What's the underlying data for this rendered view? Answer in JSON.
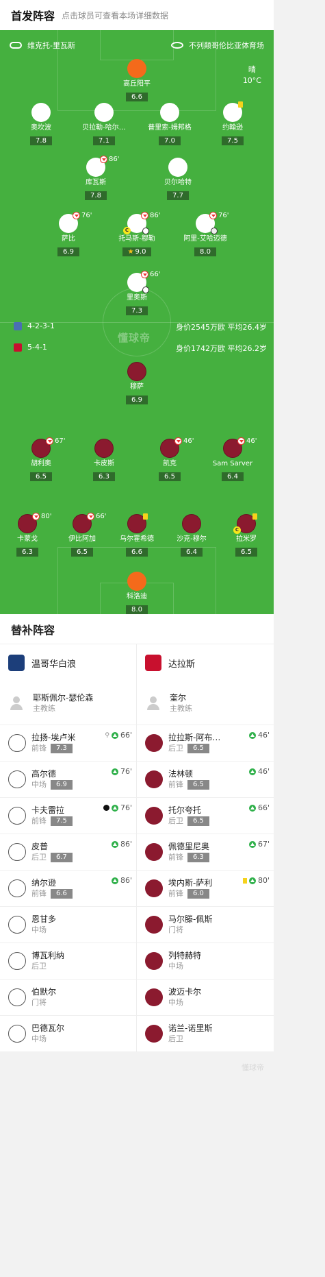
{
  "header": {
    "title": "首发阵容",
    "hint": "点击球员可查看本场详细数据"
  },
  "match": {
    "referee": "维克托-里瓦斯",
    "stadium": "不列颠哥伦比亚体育场",
    "weather": "晴",
    "temperature": "10°C",
    "watermark": "懂球帝"
  },
  "home": {
    "formation": "4-2-3-1",
    "value_text": "身价2545万欧 平均26.4岁",
    "players": [
      {
        "name": "高丘阳平",
        "rating": "6.6",
        "kit": "gk"
      },
      {
        "name": "奥坎波",
        "rating": "7.8",
        "kit": "white"
      },
      {
        "name": "贝拉勒-哈尔…",
        "rating": "7.1",
        "kit": "white"
      },
      {
        "name": "普里索-姆邦格",
        "rating": "7.0",
        "kit": "white"
      },
      {
        "name": "约翰逊",
        "rating": "7.5",
        "kit": "white",
        "yellow": true
      },
      {
        "name": "库瓦斯",
        "rating": "7.8",
        "kit": "white",
        "sub_out": "86'"
      },
      {
        "name": "贝尔哈特",
        "rating": "7.7",
        "kit": "white"
      },
      {
        "name": "萨比",
        "rating": "6.9",
        "kit": "white",
        "sub_out": "76'"
      },
      {
        "name": "托马斯-穆勒",
        "rating": "9.0",
        "kit": "white",
        "sub_out": "86'",
        "captain": "C",
        "goal": true,
        "mvp": true
      },
      {
        "name": "阿里-艾哈迈德",
        "rating": "8.0",
        "kit": "white",
        "sub_out": "76'",
        "assist": true
      },
      {
        "name": "里奥斯",
        "rating": "7.3",
        "kit": "white",
        "sub_out": "66'",
        "goal": true
      }
    ]
  },
  "away": {
    "formation": "5-4-1",
    "value_text": "身价1742万欧 平均26.2岁",
    "players": [
      {
        "name": "穆萨",
        "rating": "6.9",
        "kit": "red"
      },
      {
        "name": "胡利奥",
        "rating": "6.5",
        "kit": "red",
        "sub_out": "67'"
      },
      {
        "name": "卡皮斯",
        "rating": "6.3",
        "kit": "red"
      },
      {
        "name": "凯克",
        "rating": "6.5",
        "kit": "red",
        "sub_out": "46'"
      },
      {
        "name": "Sam Sarver",
        "rating": "6.4",
        "kit": "red",
        "sub_out": "46'"
      },
      {
        "name": "卡蒙戈",
        "rating": "6.3",
        "kit": "red",
        "sub_out": "80'"
      },
      {
        "name": "伊比阿加",
        "rating": "6.5",
        "kit": "red",
        "sub_out": "66'"
      },
      {
        "name": "乌尔霍希德",
        "rating": "6.6",
        "kit": "red",
        "yellow": true
      },
      {
        "name": "沙克-穆尔",
        "rating": "6.4",
        "kit": "red"
      },
      {
        "name": "拉米罗",
        "rating": "6.5",
        "kit": "red",
        "yellow": true,
        "captain": "C"
      },
      {
        "name": "科洛迪",
        "rating": "8.0",
        "kit": "gk"
      }
    ]
  },
  "subs": {
    "title": "替补阵容",
    "home": {
      "team": "温哥华白浪",
      "coach": "耶斯佩尔-瑟伦森",
      "coach_role": "主教练",
      "list": [
        {
          "name": "拉扬-埃卢米",
          "pos": "前锋",
          "rating": "7.3",
          "minute": "66'",
          "assist": true
        },
        {
          "name": "高尔德",
          "pos": "中场",
          "rating": "6.9",
          "minute": "76'"
        },
        {
          "name": "卡夫雷拉",
          "pos": "前锋",
          "rating": "7.5",
          "minute": "76'",
          "goal": true
        },
        {
          "name": "皮普",
          "pos": "后卫",
          "rating": "6.7",
          "minute": "86'"
        },
        {
          "name": "纳尔逊",
          "pos": "前锋",
          "rating": "6.6",
          "minute": "86'"
        },
        {
          "name": "恩甘多",
          "pos": "中场"
        },
        {
          "name": "博瓦利纳",
          "pos": "后卫"
        },
        {
          "name": "伯默尔",
          "pos": "门将"
        },
        {
          "name": "巴德瓦尔",
          "pos": "中场"
        }
      ]
    },
    "away": {
      "team": "达拉斯",
      "coach": "奎尔",
      "coach_role": "主教练",
      "list": [
        {
          "name": "拉拉斯-阿布…",
          "pos": "后卫",
          "rating": "6.5",
          "minute": "46'"
        },
        {
          "name": "法林顿",
          "pos": "前锋",
          "rating": "6.5",
          "minute": "46'"
        },
        {
          "name": "托尔夸托",
          "pos": "后卫",
          "rating": "6.5",
          "minute": "66'"
        },
        {
          "name": "佩德里尼奥",
          "pos": "前锋",
          "rating": "6.3",
          "minute": "67'"
        },
        {
          "name": "埃内斯-萨利",
          "pos": "前锋",
          "rating": "6.0",
          "minute": "80'",
          "yellow": true
        },
        {
          "name": "马尔滕-佩斯",
          "pos": "门将"
        },
        {
          "name": "列特赫特",
          "pos": "中场"
        },
        {
          "name": "波迈卡尔",
          "pos": "中场"
        },
        {
          "name": "诺兰-诺里斯",
          "pos": "后卫"
        }
      ]
    }
  },
  "footer": {
    "watermark": "懂球帝"
  },
  "colors": {
    "pitch": "#45b03f",
    "away_kit": "#8b1a2f",
    "gk_kit": "#f46a1b",
    "rating_bg": "#2f6b2b"
  }
}
